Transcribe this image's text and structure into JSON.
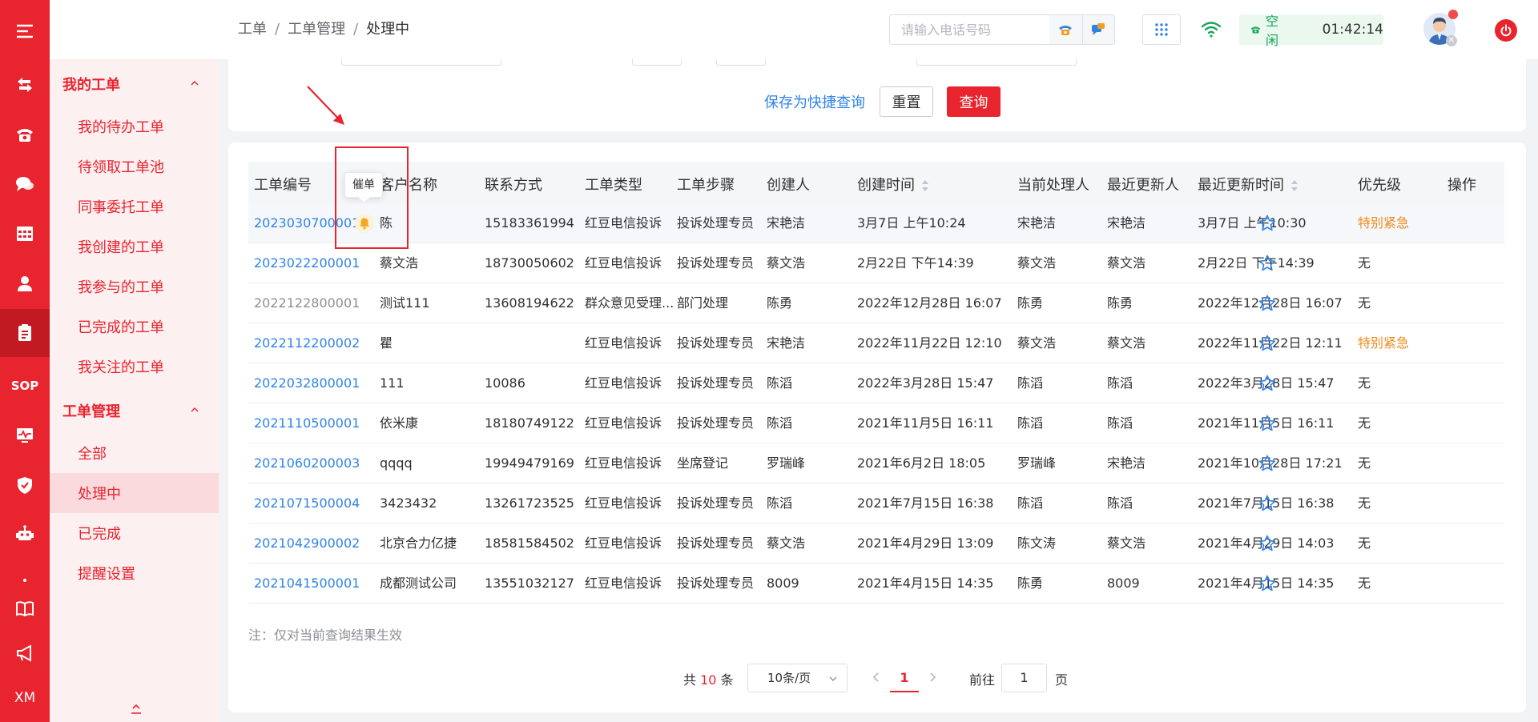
{
  "rail": {
    "sop_label": "SOP",
    "xm_label": "XM",
    "icons": [
      "menu-icon",
      "transfer-icon",
      "phone-icon",
      "chat-icon",
      "grid-icon",
      "person-icon",
      "clipboard-icon",
      "sop-icon",
      "monitor-icon",
      "shield-icon",
      "robot-icon",
      "dot-icon",
      "book-icon",
      "megaphone-icon",
      "xm-icon"
    ]
  },
  "sidebar": {
    "groups": [
      {
        "label": "我的工单",
        "items": [
          "我的待办工单",
          "待领取工单池",
          "同事委托工单",
          "我创建的工单",
          "我参与的工单",
          "已完成的工单",
          "我关注的工单"
        ]
      },
      {
        "label": "工单管理",
        "items": [
          "全部",
          "处理中",
          "已完成",
          "提醒设置"
        ]
      }
    ],
    "active_item": "处理中"
  },
  "topbar": {
    "breadcrumb": [
      "工单",
      "工单管理",
      "处理中"
    ],
    "phone_placeholder": "请输入电话号码",
    "status_label": "空闲",
    "status_time": "01:42:14"
  },
  "search": {
    "save_quick_label": "保存为快捷查询",
    "reset_label": "重置",
    "query_label": "查询"
  },
  "table": {
    "columns": [
      "工单编号",
      "客户名称",
      "联系方式",
      "工单类型",
      "工单步骤",
      "创建人",
      "创建时间",
      "当前处理人",
      "最近更新人",
      "最近更新时间",
      "优先级",
      "操作"
    ],
    "rows": [
      [
        "2023030700001",
        "陈",
        "15183361994",
        "红豆电信投诉",
        "投诉处理专员",
        "宋艳洁",
        "3月7日 上午10:24",
        "宋艳洁",
        "宋艳洁",
        "3月7日 上午10:30",
        "特别紧急"
      ],
      [
        "2023022200001",
        "蔡文浩",
        "18730050602",
        "红豆电信投诉",
        "投诉处理专员",
        "蔡文浩",
        "2月22日 下午14:39",
        "蔡文浩",
        "蔡文浩",
        "2月22日 下午14:39",
        "无"
      ],
      [
        "2022122800001",
        "测试111",
        "13608194622",
        "群众意见受理...",
        "部门处理",
        "陈勇",
        "2022年12月28日 16:07",
        "陈勇",
        "陈勇",
        "2022年12月28日 16:07",
        "无"
      ],
      [
        "2022112200002",
        "瞿",
        "",
        "红豆电信投诉",
        "投诉处理专员",
        "宋艳洁",
        "2022年11月22日 12:10",
        "蔡文浩",
        "蔡文浩",
        "2022年11月22日 12:11",
        "特别紧急"
      ],
      [
        "2022032800001",
        "111",
        "10086",
        "红豆电信投诉",
        "投诉处理专员",
        "陈滔",
        "2022年3月28日 15:47",
        "陈滔",
        "陈滔",
        "2022年3月28日 15:47",
        "无"
      ],
      [
        "2021110500001",
        "依米康",
        "18180749122",
        "红豆电信投诉",
        "投诉处理专员",
        "陈滔",
        "2021年11月5日 16:11",
        "陈滔",
        "陈滔",
        "2021年11月5日 16:11",
        "无"
      ],
      [
        "2021060200003",
        "qqqq",
        "19949479169",
        "红豆电信投诉",
        "坐席登记",
        "罗瑞峰",
        "2021年6月2日 18:05",
        "罗瑞峰",
        "宋艳洁",
        "2021年10月28日 17:21",
        "无"
      ],
      [
        "2021071500004",
        "3423432",
        "13261723525",
        "红豆电信投诉",
        "投诉处理专员",
        "陈滔",
        "2021年7月15日 16:38",
        "陈滔",
        "陈滔",
        "2021年7月15日 16:38",
        "无"
      ],
      [
        "2021042900002",
        "北京合力亿捷",
        "18581584502",
        "红豆电信投诉",
        "投诉处理专员",
        "蔡文浩",
        "2021年4月29日 13:09",
        "陈文涛",
        "蔡文浩",
        "2021年4月29日 14:03",
        "无"
      ],
      [
        "2021041500001",
        "成都测试公司",
        "13551032127",
        "红豆电信投诉",
        "投诉处理专员",
        "8009",
        "2021年4月15日 14:35",
        "陈勇",
        "8009",
        "2021年4月15日 14:35",
        "无"
      ]
    ],
    "tooltip": "催单",
    "note": "注：仅对当前查询结果生效"
  },
  "pager": {
    "total_prefix": "共",
    "total": "10",
    "total_suffix": "条",
    "page_size": "10条/页",
    "current": "1",
    "goto_label": "前往",
    "goto_value": "1",
    "page_suffix": "页"
  },
  "colors": {
    "brand": "#e8242e",
    "link": "#2f83e8",
    "urgent": "#f08a1c",
    "idle": "#19a35a"
  }
}
